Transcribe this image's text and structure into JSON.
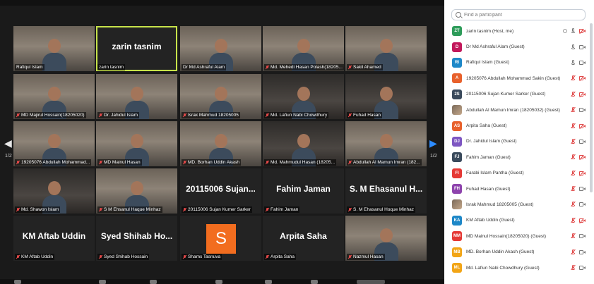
{
  "gallery": {
    "page_indicator_left": "1/2",
    "page_indicator_right": "1/2",
    "tiles": [
      {
        "label": "Rafiqul Islam",
        "muted": false,
        "style": "video"
      },
      {
        "label": "zarin tasnim",
        "big": "zarin tasnim",
        "muted": false,
        "style": "name",
        "active": true
      },
      {
        "label": "Dr Md Ashraful Alam",
        "muted": false,
        "style": "video"
      },
      {
        "label": "Md. Mehedi Hasan Polash(18205...",
        "muted": true,
        "style": "video"
      },
      {
        "label": "Sakil Ahamed",
        "muted": true,
        "style": "video"
      },
      {
        "label": "MD Majirul Hossain(18205020)",
        "muted": true,
        "style": "video"
      },
      {
        "label": "Dr. Jahidul Islam",
        "muted": true,
        "style": "video"
      },
      {
        "label": "Israk Mahmud 18205005",
        "muted": true,
        "style": "video"
      },
      {
        "label": "Md. Lafiun Nabi Chowdhury",
        "muted": true,
        "style": "dark"
      },
      {
        "label": "Fuhad Hasan",
        "muted": true,
        "style": "dark"
      },
      {
        "label": "19205076 Abdullah Mohammad...",
        "muted": true,
        "style": "video"
      },
      {
        "label": "MD Mainul Hasan",
        "muted": true,
        "style": "video"
      },
      {
        "label": "MD. Borhan Uddin Akash",
        "muted": true,
        "style": "video"
      },
      {
        "label": "Md. Mahmudul Hasan (18205...",
        "muted": true,
        "style": "dark"
      },
      {
        "label": "Abdullah Al Mamun Imran (182...",
        "muted": true,
        "style": "video"
      },
      {
        "label": "Md. Shawon Islam",
        "muted": true,
        "style": "dark"
      },
      {
        "label": "S M Ehsanul Haque Minhaz",
        "muted": true,
        "style": "video"
      },
      {
        "label": "20115006 Sujan Kumer Sarker",
        "big": "20115006 Sujan...",
        "muted": true,
        "style": "name"
      },
      {
        "label": "Fahim Jaman",
        "big": "Fahim Jaman",
        "muted": true,
        "style": "name"
      },
      {
        "label": "S. M Ehasanul Hoque Minhaz",
        "big": "S. M Ehasanul H...",
        "muted": true,
        "style": "name"
      },
      {
        "label": "KM Aftab Uddin",
        "big": "KM Aftab Uddin",
        "muted": true,
        "style": "name"
      },
      {
        "label": "Syed Shihab Hossain",
        "big": "Syed Shihab Ho...",
        "muted": true,
        "style": "name"
      },
      {
        "label": "Shams Tasnuva",
        "avatar": "S",
        "muted": true,
        "style": "avatar"
      },
      {
        "label": "Arpita Saha",
        "big": "Arpita Saha",
        "muted": true,
        "style": "name"
      },
      {
        "label": "Nazmul Hasan",
        "muted": true,
        "style": "video"
      }
    ]
  },
  "panel": {
    "search_placeholder": "Find a participant",
    "participants": [
      {
        "initials": "ZT",
        "color": "#2e9c5a",
        "name": "zarin tasnim (Host, me)",
        "mic": "on",
        "cam": "off",
        "extra": true
      },
      {
        "initials": "D",
        "color": "#c2185b",
        "name": "Dr Md Ashraful Alam (Guest)",
        "mic": "on",
        "cam": "on"
      },
      {
        "initials": "RI",
        "color": "#1e88c8",
        "name": "Rafiqul Islam (Guest)",
        "mic": "on",
        "cam": "on"
      },
      {
        "initials": "A",
        "color": "#e8612c",
        "name": "19205076 Abdullah Mohammad Sakin (Guest)",
        "mic": "muted",
        "cam": "off"
      },
      {
        "initials": "2S",
        "color": "#3a4a5c",
        "name": "20115006 Sujan Kumer Sarker (Guest)",
        "mic": "muted",
        "cam": "off"
      },
      {
        "initials": "",
        "color": "photo",
        "name": "Abdullah Al Mamun Imran (18205032) (Guest)",
        "mic": "muted",
        "cam": "on"
      },
      {
        "initials": "AS",
        "color": "#e8612c",
        "name": "Arpita Saha (Guest)",
        "mic": "muted",
        "cam": "off"
      },
      {
        "initials": "DJ",
        "color": "#7e57c2",
        "name": "Dr. Jahidul Islam (Guest)",
        "mic": "muted",
        "cam": "on"
      },
      {
        "initials": "FJ",
        "color": "#3a4a5c",
        "name": "Fahim Jaman (Guest)",
        "mic": "muted",
        "cam": "off"
      },
      {
        "initials": "FI",
        "color": "#e53935",
        "name": "Farabi Islam Pantha (Guest)",
        "mic": "muted",
        "cam": "off"
      },
      {
        "initials": "FH",
        "color": "#8e44ad",
        "name": "Fuhad Hasan (Guest)",
        "mic": "muted",
        "cam": "on"
      },
      {
        "initials": "",
        "color": "photo",
        "name": "Israk Mahmud 18205005 (Guest)",
        "mic": "muted",
        "cam": "on"
      },
      {
        "initials": "KA",
        "color": "#1e88c8",
        "name": "KM Aftab Uddin (Guest)",
        "mic": "muted",
        "cam": "off"
      },
      {
        "initials": "MM",
        "color": "#e53935",
        "name": "MD Mainul Hossain(18205020) (Guest)",
        "mic": "muted",
        "cam": "on"
      },
      {
        "initials": "MB",
        "color": "#f2a516",
        "name": "MD. Borhan Uddin Akash (Guest)",
        "mic": "muted",
        "cam": "on"
      },
      {
        "initials": "ML",
        "color": "#f2a516",
        "name": "Md. Lafiun Nabi Chowdhury (Guest)",
        "mic": "muted",
        "cam": "on"
      }
    ]
  }
}
